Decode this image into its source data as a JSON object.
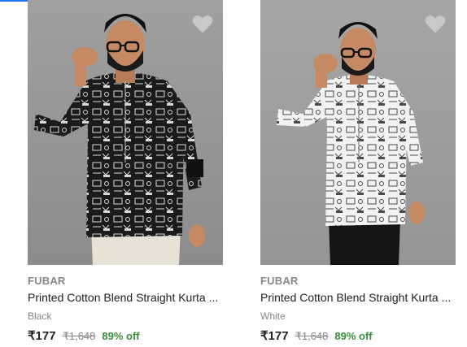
{
  "colors": {
    "accent": "#2874f0",
    "brand_text": "#878787",
    "title_text": "#212121",
    "discount": "#388e3c"
  },
  "products": [
    {
      "brand": "FUBAR",
      "title": "Printed Cotton Blend Straight Kurta ...",
      "color": "Black",
      "price": "₹177",
      "mrp": "₹1,648",
      "discount": "89% off",
      "wishlist_icon": "heart-icon"
    },
    {
      "brand": "FUBAR",
      "title": "Printed Cotton Blend Straight Kurta ...",
      "color": "White",
      "price": "₹177",
      "mrp": "₹1,648",
      "discount": "89% off",
      "wishlist_icon": "heart-icon"
    }
  ]
}
